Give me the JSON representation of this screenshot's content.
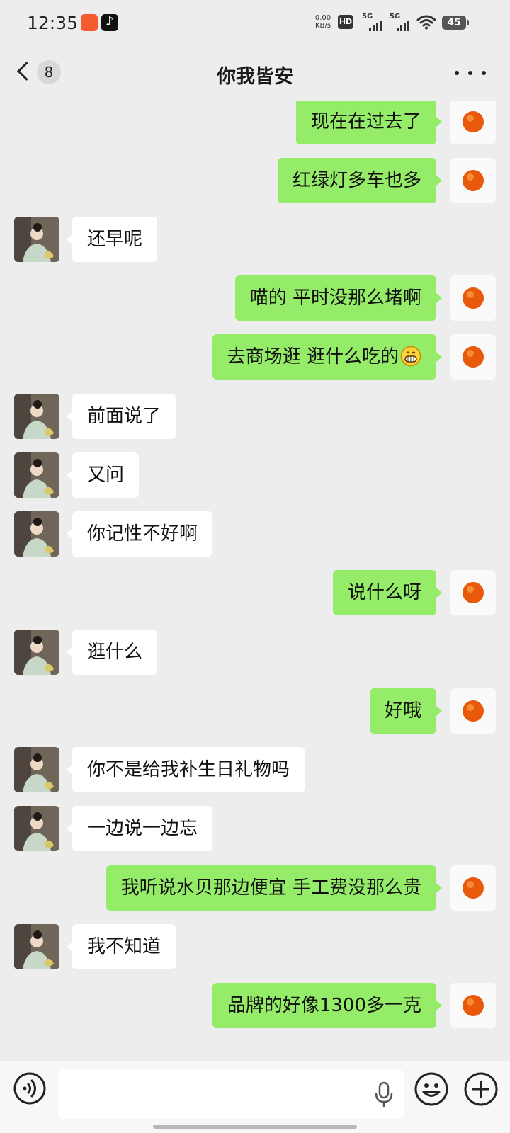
{
  "status_bar": {
    "time": "12:35",
    "net_speed_value": "0.00",
    "net_speed_unit": "KB/s",
    "hd_label": "HD",
    "signal_1_label": "5G",
    "signal_2_label": "5G",
    "battery": "45"
  },
  "header": {
    "back_unread_count": "8",
    "title": "你我皆安",
    "more_icon": "more-dots-icon"
  },
  "colors": {
    "background": "#ededed",
    "outgoing_bubble": "#95ec69",
    "incoming_bubble": "#ffffff"
  },
  "messages": [
    {
      "direction": "out",
      "text": "现在在过去了"
    },
    {
      "direction": "out",
      "text": "红绿灯多车也多"
    },
    {
      "direction": "in",
      "text": "还早呢"
    },
    {
      "direction": "out",
      "text": "喵的 平时没那么堵啊"
    },
    {
      "direction": "out",
      "text": "去商场逛 逛什么吃的",
      "emoji": "grinning-face-emoji"
    },
    {
      "direction": "in",
      "text": "前面说了"
    },
    {
      "direction": "in",
      "text": "又问"
    },
    {
      "direction": "in",
      "text": "你记性不好啊"
    },
    {
      "direction": "out",
      "text": "说什么呀"
    },
    {
      "direction": "in",
      "text": "逛什么"
    },
    {
      "direction": "out",
      "text": "好哦"
    },
    {
      "direction": "in",
      "text": "你不是给我补生日礼物吗"
    },
    {
      "direction": "in",
      "text": "一边说一边忘"
    },
    {
      "direction": "out",
      "text": "我听说水贝那边便宜 手工费没那么贵"
    },
    {
      "direction": "in",
      "text": "我不知道"
    },
    {
      "direction": "out",
      "text": "品牌的好像1300多一克"
    }
  ],
  "input_bar": {
    "text_value": "",
    "voice_icon": "voice-icon",
    "mic_icon": "mic-icon",
    "emoji_icon": "emoji-icon",
    "plus_icon": "plus-icon"
  }
}
